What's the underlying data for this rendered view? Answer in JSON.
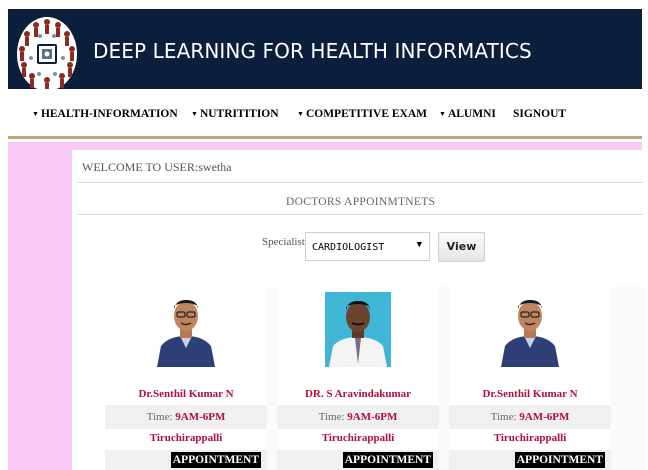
{
  "header": {
    "title": "DEEP LEARNING FOR HEALTH INFORMATICS",
    "logo_icon": "health-informatics-logo"
  },
  "nav": {
    "items": [
      {
        "label": "HEALTH-INFORMATION",
        "has_caret": true
      },
      {
        "label": "NUTRITITION",
        "has_caret": true
      },
      {
        "label": "COMPETITIVE EXAM",
        "has_caret": true
      },
      {
        "label": "ALUMNI",
        "has_caret": true
      },
      {
        "label": "SIGNOUT",
        "has_caret": false
      }
    ]
  },
  "main": {
    "welcome": "WELCOME TO USER:swetha",
    "section_title": "DOCTORS APPOINMTNETS",
    "specialist_label": "Specialist",
    "specialist_value": "CARDIOLOGIST",
    "view_label": "View"
  },
  "doctors": [
    {
      "name": "Dr.Senthil Kumar N",
      "time_label": "Time:",
      "time": "9AM-6PM",
      "city": "Tiruchirappalli",
      "button": "APPOINTMENT"
    },
    {
      "name": "DR. S Aravindakumar",
      "time_label": "Time:",
      "time": "9AM-6PM",
      "city": "Tiruchirappalli",
      "button": "APPOINTMENT"
    },
    {
      "name": "Dr.Senthil Kumar N",
      "time_label": "Time:",
      "time": "9AM-6PM",
      "city": "Tiruchirappalli",
      "button": "APPOINTMENT"
    }
  ],
  "colors": {
    "header_bg": "#0b1f3c",
    "page_bg": "#fbc9f6",
    "accent_text": "#b0103a",
    "nav_border": "#c9a27a"
  }
}
